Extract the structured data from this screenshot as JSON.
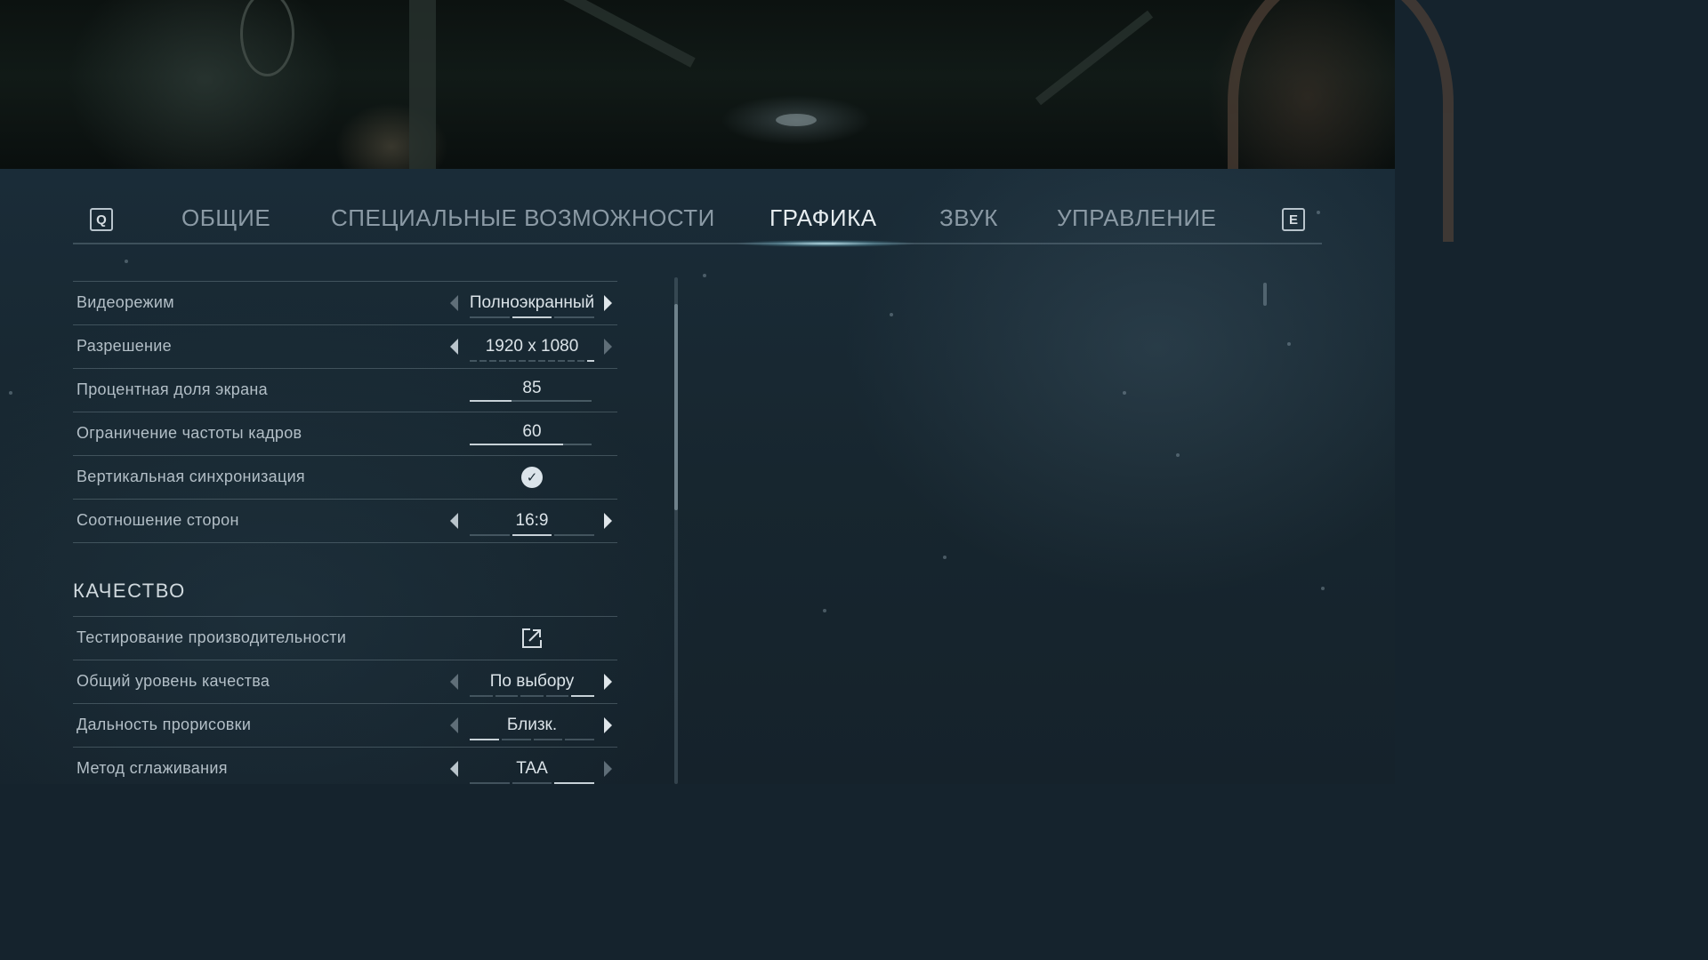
{
  "tabs": {
    "prev_key": "Q",
    "next_key": "E",
    "items": [
      {
        "label": "ОБЩИЕ",
        "active": false
      },
      {
        "label": "СПЕЦИАЛЬНЫЕ ВОЗМОЖНОСТИ",
        "active": false
      },
      {
        "label": "ГРАФИКА",
        "active": true
      },
      {
        "label": "ЗВУК",
        "active": false
      },
      {
        "label": "УПРАВЛЕНИЕ",
        "active": false
      }
    ]
  },
  "display": {
    "video_mode": {
      "label": "Видеорежим",
      "value": "Полноэкранный"
    },
    "resolution": {
      "label": "Разрешение",
      "value": "1920 x 1080"
    },
    "screen_percentage": {
      "label": "Процентная доля экрана",
      "value": "85",
      "fraction": 0.34
    },
    "frame_limit": {
      "label": "Ограничение частоты кадров",
      "value": "60",
      "fraction": 0.77
    },
    "vsync": {
      "label": "Вертикальная синхронизация",
      "checked": true
    },
    "aspect_ratio": {
      "label": "Соотношение сторон",
      "value": "16:9"
    }
  },
  "quality": {
    "heading": "КАЧЕСТВО",
    "benchmark": {
      "label": "Тестирование производительности"
    },
    "overall_quality": {
      "label": "Общий уровень качества",
      "value": "По выбору"
    },
    "draw_distance": {
      "label": "Дальность прорисовки",
      "value": "Близк."
    },
    "anti_aliasing": {
      "label": "Метод сглаживания",
      "value": "TAA"
    }
  },
  "colors": {
    "accent": "#bfe4ee",
    "panel": "#17262f"
  }
}
